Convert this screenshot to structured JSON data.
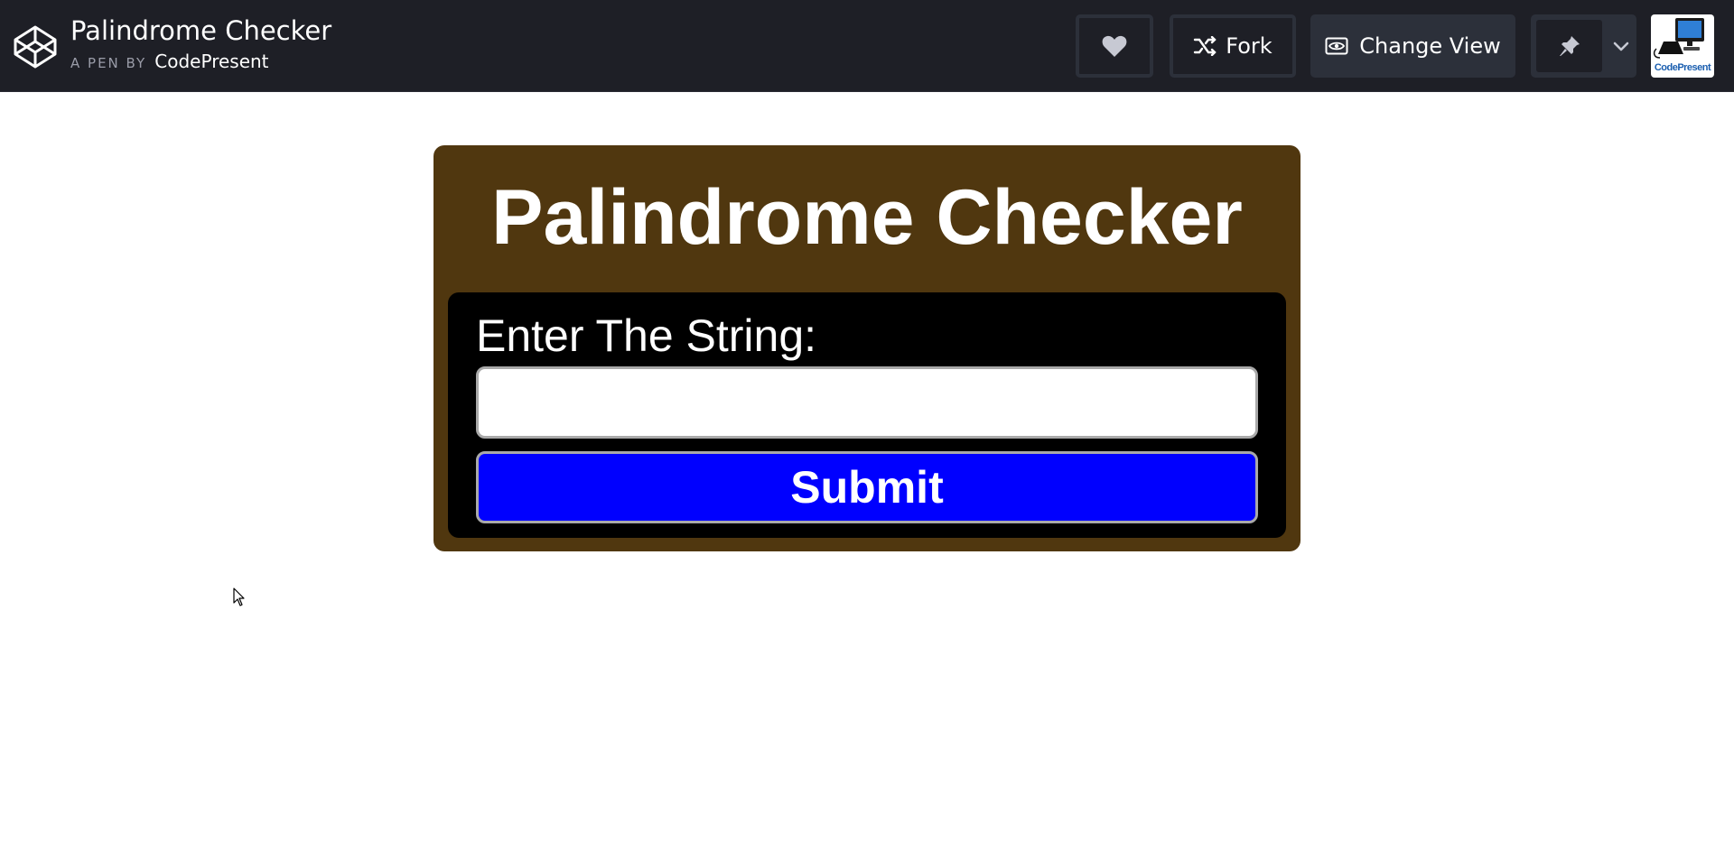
{
  "header": {
    "title": "Palindrome Checker",
    "by_label": "A PEN BY",
    "author": "CodePresent",
    "logo_icon": "codepen-cube-icon",
    "buttons": {
      "heart_icon": "heart-icon",
      "fork_label": "Fork",
      "fork_icon": "fork-icon",
      "change_view_label": "Change View",
      "change_view_icon": "eye-icon",
      "pin_icon": "pin-icon",
      "chevron_icon": "chevron-down-icon"
    },
    "avatar_text": "CodePresent"
  },
  "app": {
    "title": "Palindrome Checker",
    "input_label": "Enter The String:",
    "input_value": "",
    "submit_label": "Submit"
  },
  "colors": {
    "topbar": "#1e1f26",
    "button_bg": "#2c303a",
    "card_bg": "#50370f",
    "inner_bg": "#000000",
    "submit_bg": "#0000ff"
  }
}
